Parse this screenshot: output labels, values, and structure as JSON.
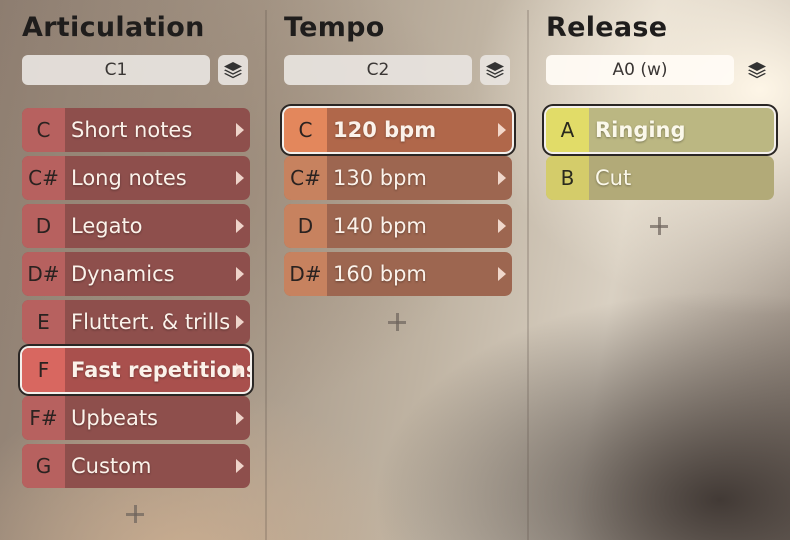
{
  "columns": {
    "articulation": {
      "title": "Articulation",
      "selector_value": "C1",
      "items": [
        {
          "key": "C",
          "label": "Short notes"
        },
        {
          "key": "C#",
          "label": "Long notes"
        },
        {
          "key": "D",
          "label": "Legato"
        },
        {
          "key": "D#",
          "label": "Dynamics"
        },
        {
          "key": "E",
          "label": "Fluttert. & trills"
        },
        {
          "key": "F",
          "label": "Fast repetitions",
          "selected": true
        },
        {
          "key": "F#",
          "label": "Upbeats"
        },
        {
          "key": "G",
          "label": "Custom"
        }
      ]
    },
    "tempo": {
      "title": "Tempo",
      "selector_value": "C2",
      "items": [
        {
          "key": "C",
          "label": "120 bpm",
          "selected": true
        },
        {
          "key": "C#",
          "label": "130 bpm"
        },
        {
          "key": "D",
          "label": "140 bpm"
        },
        {
          "key": "D#",
          "label": "160 bpm"
        }
      ]
    },
    "release": {
      "title": "Release",
      "selector_value": "A0 (w)",
      "items": [
        {
          "key": "A",
          "label": "Ringing",
          "selected": true
        },
        {
          "key": "B",
          "label": "Cut"
        }
      ]
    }
  },
  "icons": {
    "layers": "layers-icon",
    "add": "plus-icon",
    "arrow": "chevron-right-icon"
  },
  "colors": {
    "articulation_key": "#b7615f",
    "tempo_key": "#c7825f",
    "release_key": "#d4cc6a"
  }
}
